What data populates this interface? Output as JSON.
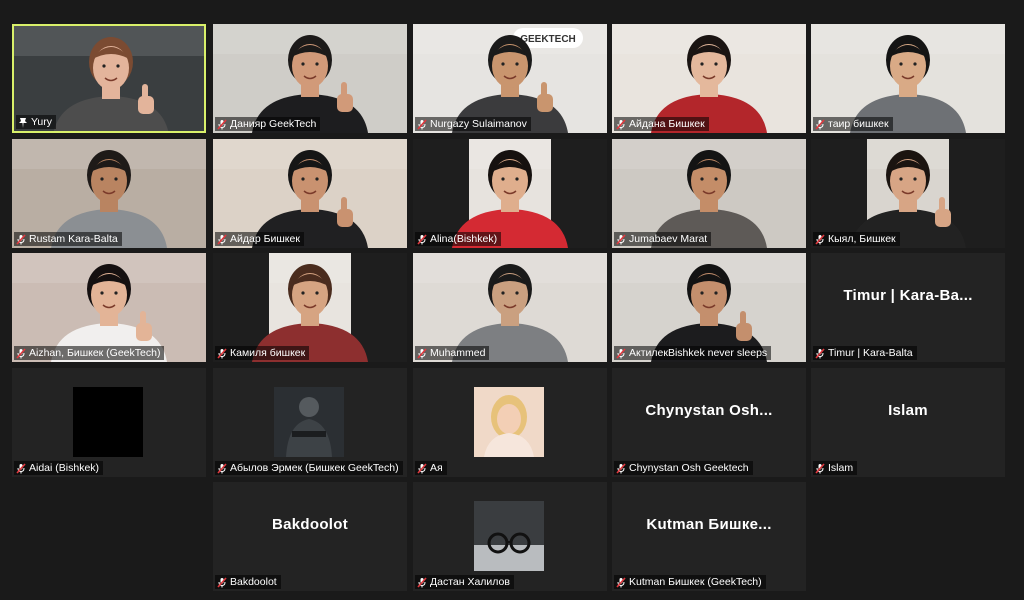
{
  "participants": [
    {
      "name": "Yury",
      "display": "video",
      "active": true,
      "mic": "host",
      "bg": "#3a3e40",
      "skin": "#e3b49b",
      "hair": "#7b4b32",
      "shirt": "#4d4d4d",
      "thumbsup": true
    },
    {
      "name": "Данияр GeekTech",
      "display": "video",
      "mic": "muted",
      "bg": "#cfcdc8",
      "skin": "#d19a79",
      "hair": "#1c1a19",
      "shirt": "#1d1d1f",
      "thumbsup": true
    },
    {
      "name": "Nurgazy Sulaimanov",
      "display": "video",
      "mic": "muted",
      "bg": "#e6e4e1",
      "skin": "#c9956e",
      "hair": "#1a1a1a",
      "shirt": "#3b3b3d",
      "thumbsup": true,
      "sign": "GEEKTECH"
    },
    {
      "name": "Айдана Бишкек",
      "display": "video",
      "mic": "muted",
      "bg": "#e9e4de",
      "skin": "#e4b89c",
      "hair": "#1a1412",
      "shirt": "#b3262b"
    },
    {
      "name": "таир бишкек",
      "display": "video",
      "mic": "muted",
      "bg": "#e4e2dd",
      "skin": "#d9aa86",
      "hair": "#141414",
      "shirt": "#6e7175"
    },
    {
      "name": "Rustam Kara-Balta",
      "display": "video",
      "mic": "muted",
      "bg": "#b9aea3",
      "skin": "#b98461",
      "hair": "#1e1a18",
      "shirt": "#8b8f93"
    },
    {
      "name": "Айдар Бишкек",
      "display": "video",
      "mic": "muted",
      "bg": "#dcd2c7",
      "skin": "#c99270",
      "hair": "#161616",
      "shirt": "#202022",
      "thumbsup": true
    },
    {
      "name": "Alina(Bishkek)",
      "display": "video",
      "mic": "muted",
      "bg": "#e7e3de",
      "skin": "#dfae8d",
      "hair": "#16110f",
      "shirt": "#d42a33",
      "narrow": true
    },
    {
      "name": "Jumabaev Marat",
      "display": "video",
      "mic": "muted",
      "bg": "#cdc9c3",
      "skin": "#c48d68",
      "hair": "#141414",
      "shirt": "#5e5a57"
    },
    {
      "name": "Кыял, Бишкек",
      "display": "video",
      "mic": "muted",
      "bg": "#d9d5cf",
      "skin": "#d7a585",
      "hair": "#1b1410",
      "shirt": "#222222",
      "narrow": true,
      "thumbsup": true
    },
    {
      "name": "Aizhan, Бишкек (GeekTech)",
      "display": "video",
      "mic": "muted",
      "bg": "#cbbcb4",
      "skin": "#e3b497",
      "hair": "#151010",
      "shirt": "#f1efee",
      "thumbsup": true
    },
    {
      "name": "Камиля бишкек",
      "display": "video",
      "mic": "muted",
      "bg": "#e8e4df",
      "skin": "#d6a482",
      "hair": "#4a2c1e",
      "shirt": "#8d2f2f",
      "narrow": true
    },
    {
      "name": "Muhammed",
      "display": "video",
      "mic": "muted",
      "bg": "#dedad5",
      "skin": "#caa080",
      "hair": "#1a1a1a",
      "shirt": "#7d7f82"
    },
    {
      "name": "АктилекBishkek never sleeps",
      "display": "video",
      "mic": "muted",
      "bg": "#d6d3ce",
      "skin": "#c48f6d",
      "hair": "#131313",
      "shirt": "#1c1c1e",
      "thumbsup": true
    },
    {
      "name": "Timur | Kara-Balta",
      "display": "text",
      "label": "Timur | Kara-Ba...",
      "mic": "muted"
    },
    {
      "name": "Aidai (Bishkek)",
      "display": "thumb",
      "thumb": "black",
      "mic": "muted"
    },
    {
      "name": "Абылов Эрмек (Бишкек GeekTech)",
      "display": "thumb",
      "thumb": "soldier",
      "mic": "muted"
    },
    {
      "name": "Ая",
      "display": "thumb",
      "thumb": "girl",
      "mic": "muted"
    },
    {
      "name": "Chynystan Osh Geektech",
      "display": "text",
      "label": "Chynystan  Osh...",
      "mic": "muted"
    },
    {
      "name": "Islam",
      "display": "text",
      "label": "Islam",
      "mic": "muted"
    },
    {
      "name": "Bakdoolot",
      "display": "text",
      "label": "Bakdoolot",
      "mic": "muted"
    },
    {
      "name": "Дастан Халилов",
      "display": "thumb",
      "thumb": "glasses",
      "mic": "muted"
    },
    {
      "name": "Kutman Бишкек (GeekTech)",
      "display": "text",
      "label": "Kutman  Бишке...",
      "mic": "muted"
    }
  ],
  "colors": {
    "active_border": "#d9f06a",
    "muted_icon": "#e0383e",
    "tile_bg": "#232323",
    "page_bg": "#1a1a1a"
  }
}
